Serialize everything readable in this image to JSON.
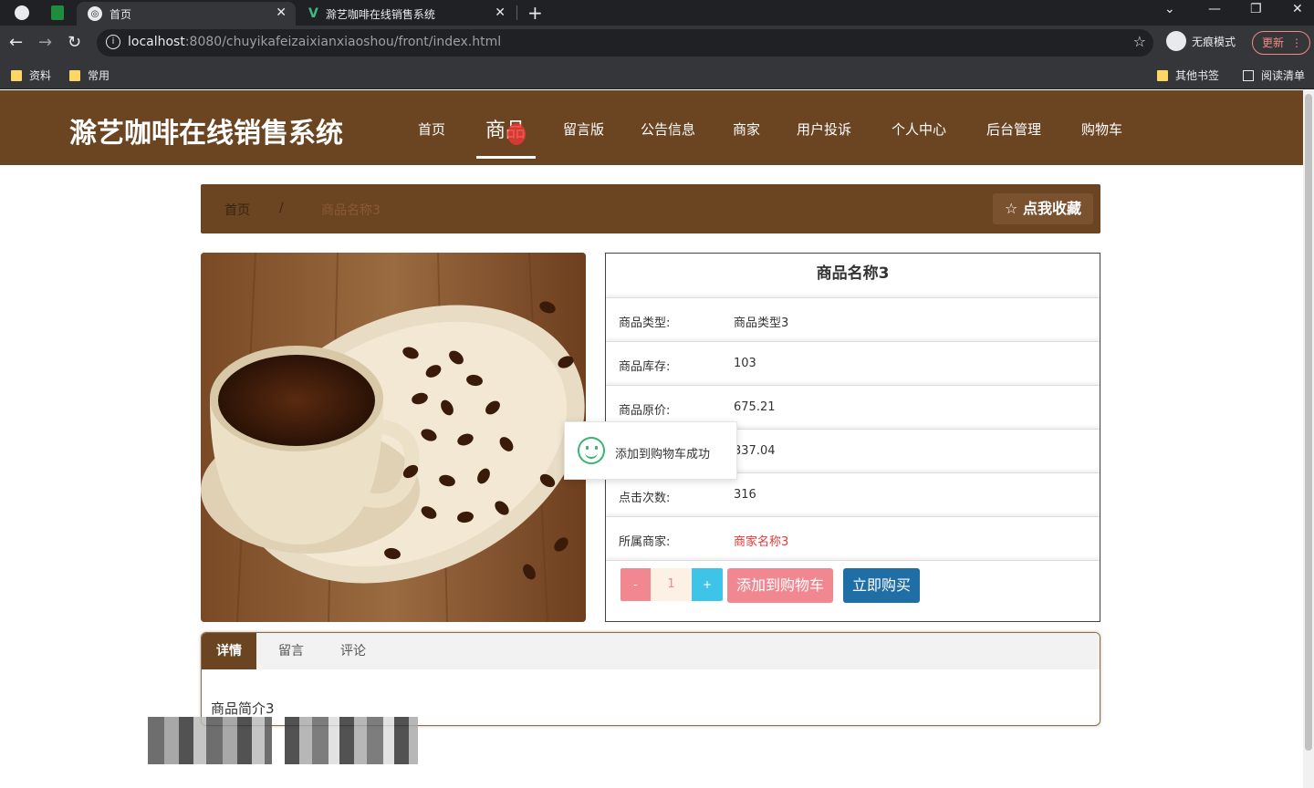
{
  "browser": {
    "tabs": [
      {
        "title": "首页"
      },
      {
        "title": "滁艺咖啡在线销售系统"
      }
    ],
    "url_host": "localhost",
    "url_path": ":8080/chuyikafeizaixianxiaoshou/front/index.html",
    "incognito_label": "无痕模式",
    "update_label": "更新",
    "bookmarks": [
      "资料",
      "常用"
    ],
    "bookmarks_right": [
      "其他书签",
      "阅读清单"
    ]
  },
  "site": {
    "title": "滁艺咖啡在线销售系统",
    "nav": [
      "首页",
      "商品",
      "留言版",
      "公告信息",
      "商家",
      "用户投诉",
      "个人中心",
      "后台管理",
      "购物车"
    ],
    "active_nav": "商品"
  },
  "breadcrumb": {
    "home": "首页",
    "sep": "/",
    "current": "商品名称3",
    "favorite_label": "☆ 点我收藏"
  },
  "product": {
    "name": "商品名称3",
    "fields": [
      {
        "label": "商品类型:",
        "value": "商品类型3"
      },
      {
        "label": "商品库存:",
        "value": "103"
      },
      {
        "label": "商品原价:",
        "value": "675.21"
      },
      {
        "label": "",
        "value": "337.04"
      },
      {
        "label": "点击次数:",
        "value": "316"
      },
      {
        "label": "所属商家:",
        "value": "商家名称3"
      }
    ],
    "quantity": "1",
    "minus_label": "-",
    "plus_label": "+",
    "add_cart_label": "添加到购物车",
    "buy_now_label": "立即购买"
  },
  "toast": {
    "message": "添加到购物车成功"
  },
  "detail_tabs": {
    "items": [
      "详情",
      "留言",
      "评论"
    ],
    "active": "详情",
    "content": "商品简介3"
  },
  "colors": {
    "brand": "#6b4421",
    "pink": "#f18790",
    "blue": "#1f6fa6",
    "cyan": "#3ec4e8"
  }
}
